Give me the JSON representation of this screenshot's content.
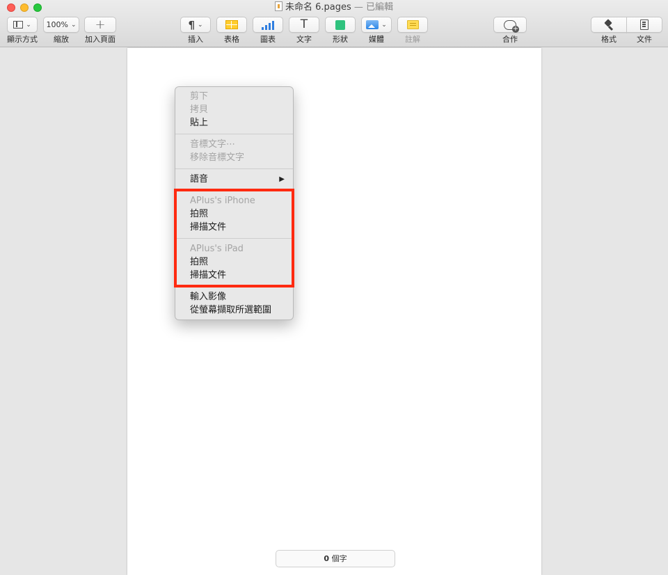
{
  "window": {
    "title": "未命名 6.pages",
    "title_sep": "—",
    "status": "已編輯"
  },
  "toolbar": {
    "view_label": "顯示方式",
    "zoom_value": "100%",
    "zoom_label": "縮放",
    "add_page_label": "加入頁面",
    "insert_label": "插入",
    "table_label": "表格",
    "chart_label": "圖表",
    "text_label": "文字",
    "text_glyph": "T",
    "shape_label": "形狀",
    "media_label": "媒體",
    "comment_label": "註解",
    "collaborate_label": "合作",
    "format_label": "格式",
    "document_label": "文件"
  },
  "context_menu": {
    "cut": "剪下",
    "copy": "拷貝",
    "paste": "貼上",
    "phonetic": "音標文字⋯",
    "remove_phonetic": "移除音標文字",
    "speech": "語音",
    "iphone_header": "APlus's iPhone",
    "iphone_take_photo": "拍照",
    "iphone_scan_doc": "掃描文件",
    "ipad_header": "APlus's iPad",
    "ipad_take_photo": "拍照",
    "ipad_scan_doc": "掃描文件",
    "import_image": "輸入影像",
    "capture_selection": "從螢幕擷取所選範圍"
  },
  "status": {
    "word_count": "0",
    "word_unit": "個字"
  },
  "colors": {
    "highlight": "#ff2a10",
    "table_icon": "#ffcd2e",
    "chart_icon": "#2f7ee0",
    "shape_icon": "#2fc27e"
  }
}
